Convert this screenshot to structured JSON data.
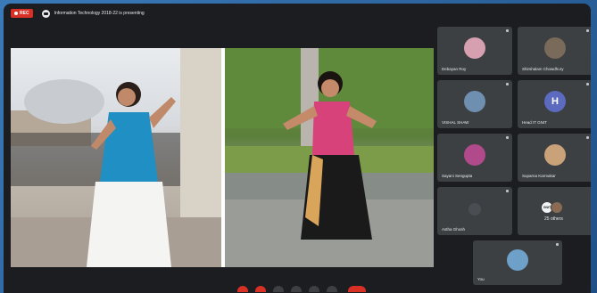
{
  "topbar": {
    "rec_label": "REC",
    "presenting_text": "Information Technology 2018-22 is presenting"
  },
  "participants": [
    {
      "name": "Debayan Roy",
      "avatar": "photo",
      "color": "#d6a0b0"
    },
    {
      "name": "Shirshalam Chowdhury",
      "avatar": "photo",
      "color": "#7a6a5a"
    },
    {
      "name": "VISHAL SHAW",
      "avatar": "photo",
      "color": "#6f8fb0"
    },
    {
      "name": "Head IT GNIT",
      "avatar": "H",
      "color": "#5c6bc0"
    },
    {
      "name": "Sayani Sengupta",
      "avatar": "photo",
      "color": "#b04a8a"
    },
    {
      "name": "Suparna Karmakar",
      "avatar": "photo",
      "color": "#c9a27a"
    },
    {
      "name": "Astha Ghosh",
      "avatar": "muted",
      "color": "#4a4e52"
    },
    {
      "name": "You",
      "avatar": "photo",
      "color": "#6fa0c8"
    }
  ],
  "others": {
    "label": "25 others",
    "first_avatar_text": "GNIT"
  },
  "colors": {
    "rec": "#d93025",
    "end_call": "#d93025",
    "tile_bg": "#3c4043"
  }
}
